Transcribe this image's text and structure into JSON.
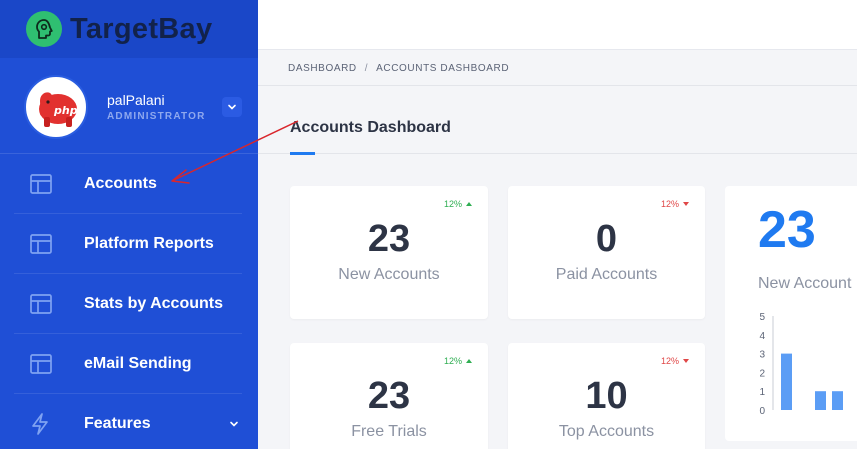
{
  "brand": {
    "name": "TargetBay",
    "logo_icon": "head-profile-icon"
  },
  "profile": {
    "name": "palPalani",
    "role": "ADMINISTRATOR",
    "avatar_icon": "php-elephant-icon"
  },
  "sidebar": {
    "items": [
      {
        "label": "Accounts",
        "icon": "layout-icon"
      },
      {
        "label": "Platform Reports",
        "icon": "layout-icon"
      },
      {
        "label": "Stats by Accounts",
        "icon": "layout-icon"
      },
      {
        "label": "eMail Sending",
        "icon": "layout-icon"
      },
      {
        "label": "Features",
        "icon": "lightning-icon",
        "has_chevron": true
      }
    ]
  },
  "breadcrumb": {
    "root": "DASHBOARD",
    "separator": "/",
    "current": "ACCOUNTS DASHBOARD"
  },
  "page": {
    "title": "Accounts Dashboard"
  },
  "cards": [
    {
      "value": "23",
      "label": "New Accounts",
      "trend": "12%",
      "direction": "up"
    },
    {
      "value": "0",
      "label": "Paid Accounts",
      "trend": "12%",
      "direction": "down"
    },
    {
      "value": "23",
      "label": "Free Trials",
      "trend": "12%",
      "direction": "up"
    },
    {
      "value": "10",
      "label": "Top Accounts",
      "trend": "12%",
      "direction": "down"
    }
  ],
  "summary_card": {
    "value": "23",
    "label": "New Account",
    "chart_data": {
      "type": "bar",
      "ylim": [
        0,
        5
      ],
      "yticks": [
        "5",
        "4",
        "3",
        "2",
        "1",
        "0"
      ],
      "values": [
        3,
        0,
        1,
        1
      ]
    }
  },
  "colors": {
    "sidebar": "#1f4fd6",
    "accent": "#1f7af0",
    "trend_up": "#2fae52",
    "trend_down": "#e04747",
    "annotation": "#d9262c"
  }
}
